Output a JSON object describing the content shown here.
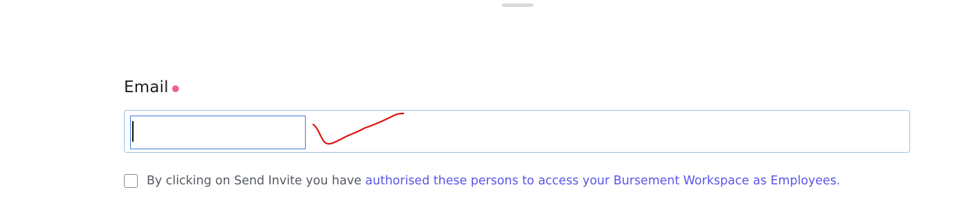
{
  "form": {
    "email_label": "Email",
    "email_value": "",
    "consent_prefix": "By clicking on Send Invite you have ",
    "consent_link": "authorised these persons to access your Bursement Workspace as Employees."
  },
  "colors": {
    "required_dot": "#f0609a",
    "link": "#5a55e8",
    "annotation": "#e01010",
    "input_focus_border": "#3b78d8",
    "container_border": "#9dc0e6"
  },
  "icons": {
    "required": "required-dot-icon",
    "annotation": "red-checkmark-annotation"
  }
}
